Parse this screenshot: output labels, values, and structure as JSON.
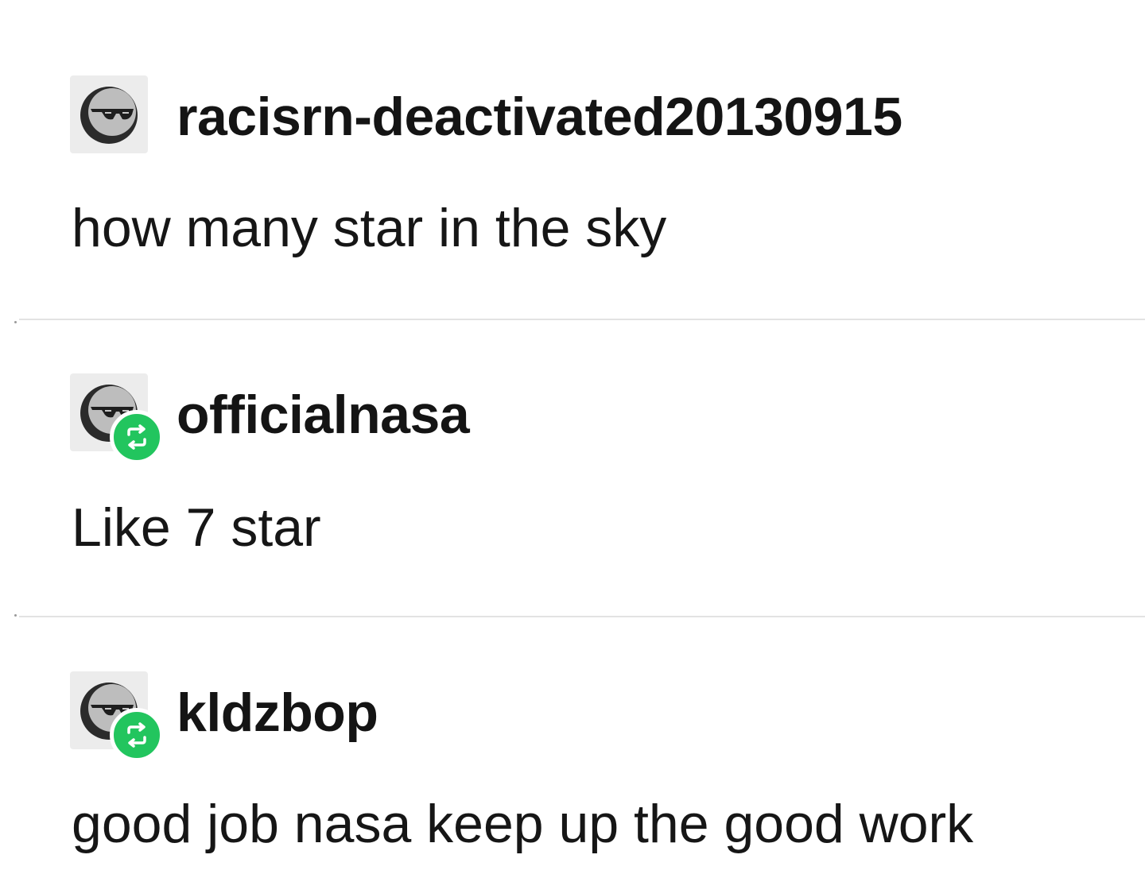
{
  "colors": {
    "reblog_badge": "#22c55e",
    "divider": "#e3e3e3",
    "avatar_bg": "#ececec"
  },
  "posts": [
    {
      "username": "racisrn-deactivated20130915",
      "avatar_icon": "sunglasses-face-icon",
      "reblogged": false,
      "text": "how many star in the sky"
    },
    {
      "username": "officialnasa",
      "avatar_icon": "sunglasses-face-icon",
      "reblogged": true,
      "badge_icon": "reblog-icon",
      "text": "Like 7 star"
    },
    {
      "username": "kldzbop",
      "avatar_icon": "sunglasses-face-icon",
      "reblogged": true,
      "badge_icon": "reblog-icon",
      "text": "good job nasa keep up the good work"
    }
  ]
}
